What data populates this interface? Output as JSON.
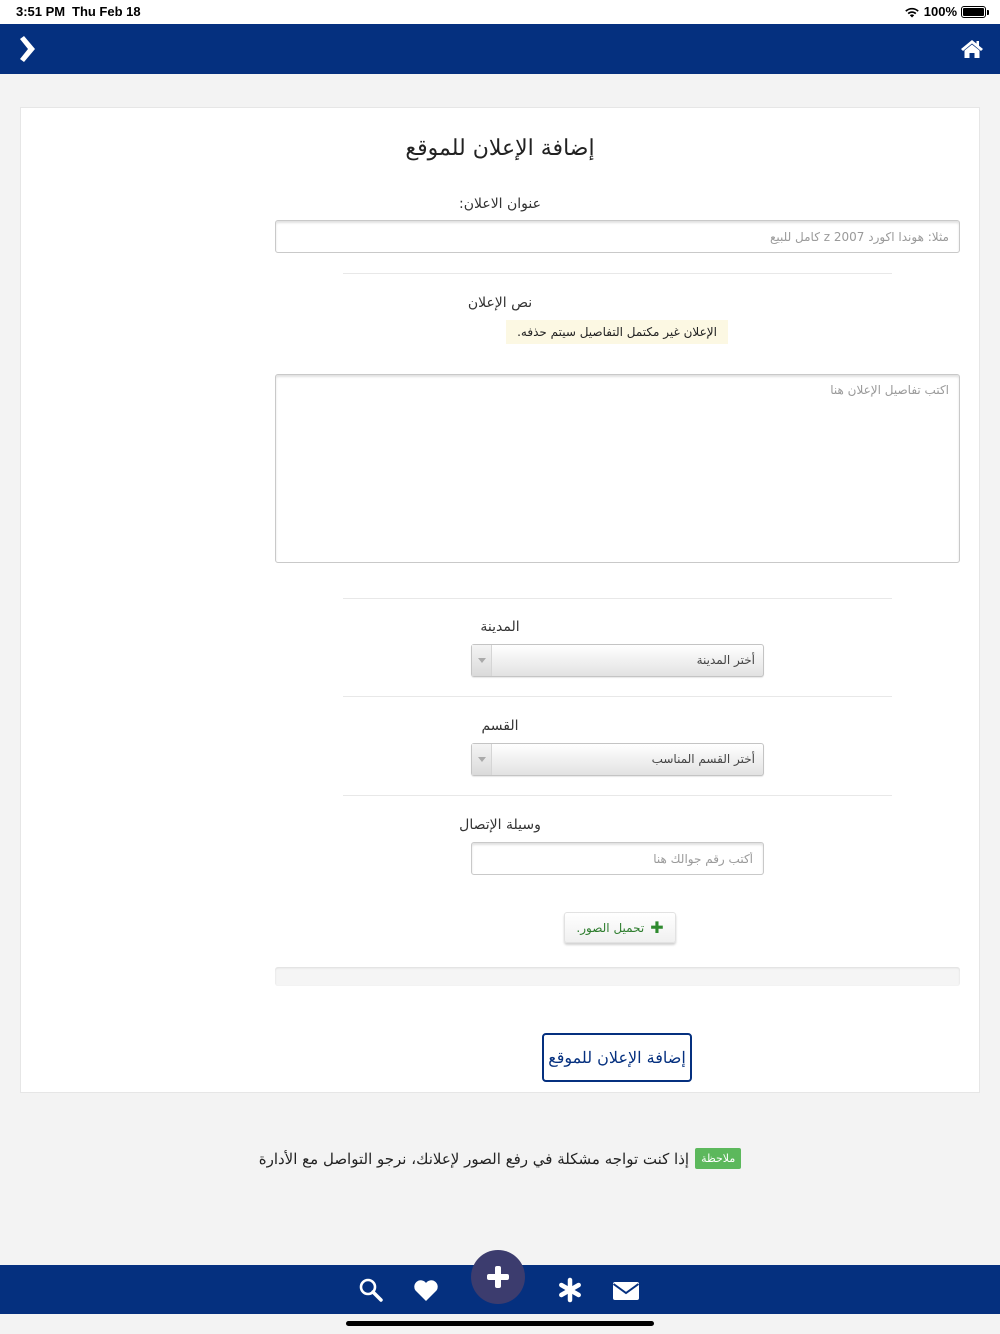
{
  "status_bar": {
    "time": "3:51 PM",
    "date": "Thu Feb 18",
    "battery": "100%",
    "battery_level": 1.0
  },
  "top_nav": {
    "back_icon": "chevron-right-icon",
    "home_icon": "home-icon",
    "background": "#05307f"
  },
  "form": {
    "title": "إضافة الإعلان للموقع",
    "ad_title": {
      "label": "عنوان الاعلان:",
      "placeholder": "مثلا: هوندا اكورد z 2007 كامل للبيع",
      "value": ""
    },
    "ad_text": {
      "label": "نص الإعلان",
      "warning": "الإعلان غير مكتمل التفاصيل سيتم حذفه.",
      "placeholder": "اكتب تفاصيل الإعلان هنا",
      "value": ""
    },
    "city": {
      "label": "المدينة",
      "selected": "أختر المدينة"
    },
    "category": {
      "label": "القسم",
      "selected": "أختر القسم المناسب"
    },
    "contact": {
      "label": "وسيلة الإتصال",
      "placeholder": "أكتب رقم جوالك هنا",
      "value": ""
    },
    "upload_label": "تحميل الصور.",
    "upload_progress": 0,
    "submit_label": "إضافة الإعلان للموقع"
  },
  "note": {
    "badge": "ملاحظة",
    "text": "إذا كنت تواجه مشكلة في رفع الصور لإعلانك، نرجو التواصل مع الأدارة"
  },
  "bottom_nav": {
    "icons": [
      "search-icon",
      "heart-icon",
      "plus-icon",
      "asterisk-icon",
      "envelope-icon"
    ],
    "background": "#05307f",
    "fab_color": "#3c3c6e"
  }
}
